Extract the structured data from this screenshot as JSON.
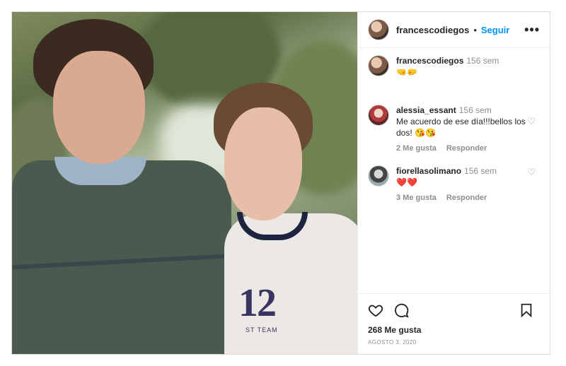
{
  "post": {
    "author": "francescodiegos",
    "follow_label": "Seguir",
    "separator": "•",
    "more_label": "•••",
    "caption": {
      "username": "francescodiegos",
      "time": "156 sem",
      "text": "🤜🤛"
    },
    "photo": {
      "jersey_number": "12",
      "jersey_text": "ST TEAM"
    }
  },
  "comments": [
    {
      "username": "alessia_essant",
      "time": "156 sem",
      "text": "Me acuerdo de ese día!!!bellos los dos! 😘😘",
      "likes_label": "2 Me gusta",
      "reply_label": "Responder"
    },
    {
      "username": "fiorellasolimano",
      "time": "156 sem",
      "text": "❤️❤️",
      "likes_label": "3 Me gusta",
      "reply_label": "Responder"
    }
  ],
  "footer": {
    "likes": "268 Me gusta",
    "date": "AGOSTO 3, 2020"
  },
  "icons": {
    "like": "heart-icon",
    "comment": "comment-icon",
    "save": "bookmark-icon",
    "comment_like": "small-heart-icon"
  },
  "colors": {
    "accent": "#0095f6",
    "border": "#dbdbdb",
    "muted": "#8e8e8e",
    "text": "#262626"
  }
}
